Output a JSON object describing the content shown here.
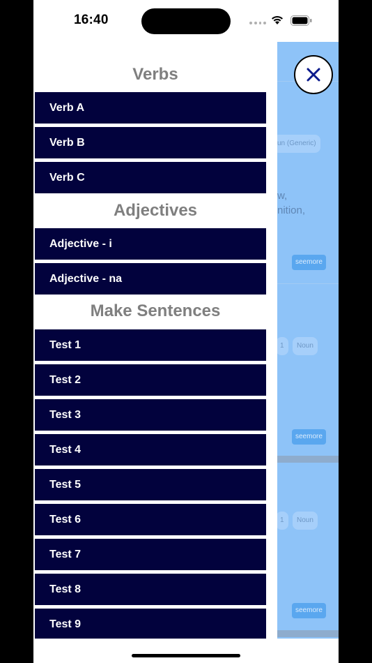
{
  "status_bar": {
    "time": "16:40",
    "icons": [
      "cellular-signal-icon",
      "wifi-icon",
      "battery-icon"
    ]
  },
  "drawer": {
    "sections": [
      {
        "title": "Verbs",
        "items": [
          "Verb A",
          "Verb B",
          "Verb C"
        ]
      },
      {
        "title": "Adjectives",
        "items": [
          "Adjective - i",
          "Adjective - na"
        ]
      },
      {
        "title": "Make Sentences",
        "items": [
          "Test 1",
          "Test 2",
          "Test 3",
          "Test 4",
          "Test 5",
          "Test 6",
          "Test 7",
          "Test 8",
          "Test 9"
        ]
      }
    ]
  },
  "close_button": {
    "icon": "close-icon",
    "color": "#0a1a8c"
  },
  "background_content": {
    "chip_1": "un (Generic)",
    "text_1": "w,",
    "text_2": "nition,",
    "seemore_label": "seemore",
    "chip_row_2_a": "1",
    "chip_row_2_b": "Noun",
    "chip_row_3_a": "1",
    "chip_row_3_b": "Noun"
  },
  "colors": {
    "menu_item_bg": "#02023d",
    "heading_text": "#7f7f7f",
    "background_panel": "#8ec3f8"
  }
}
